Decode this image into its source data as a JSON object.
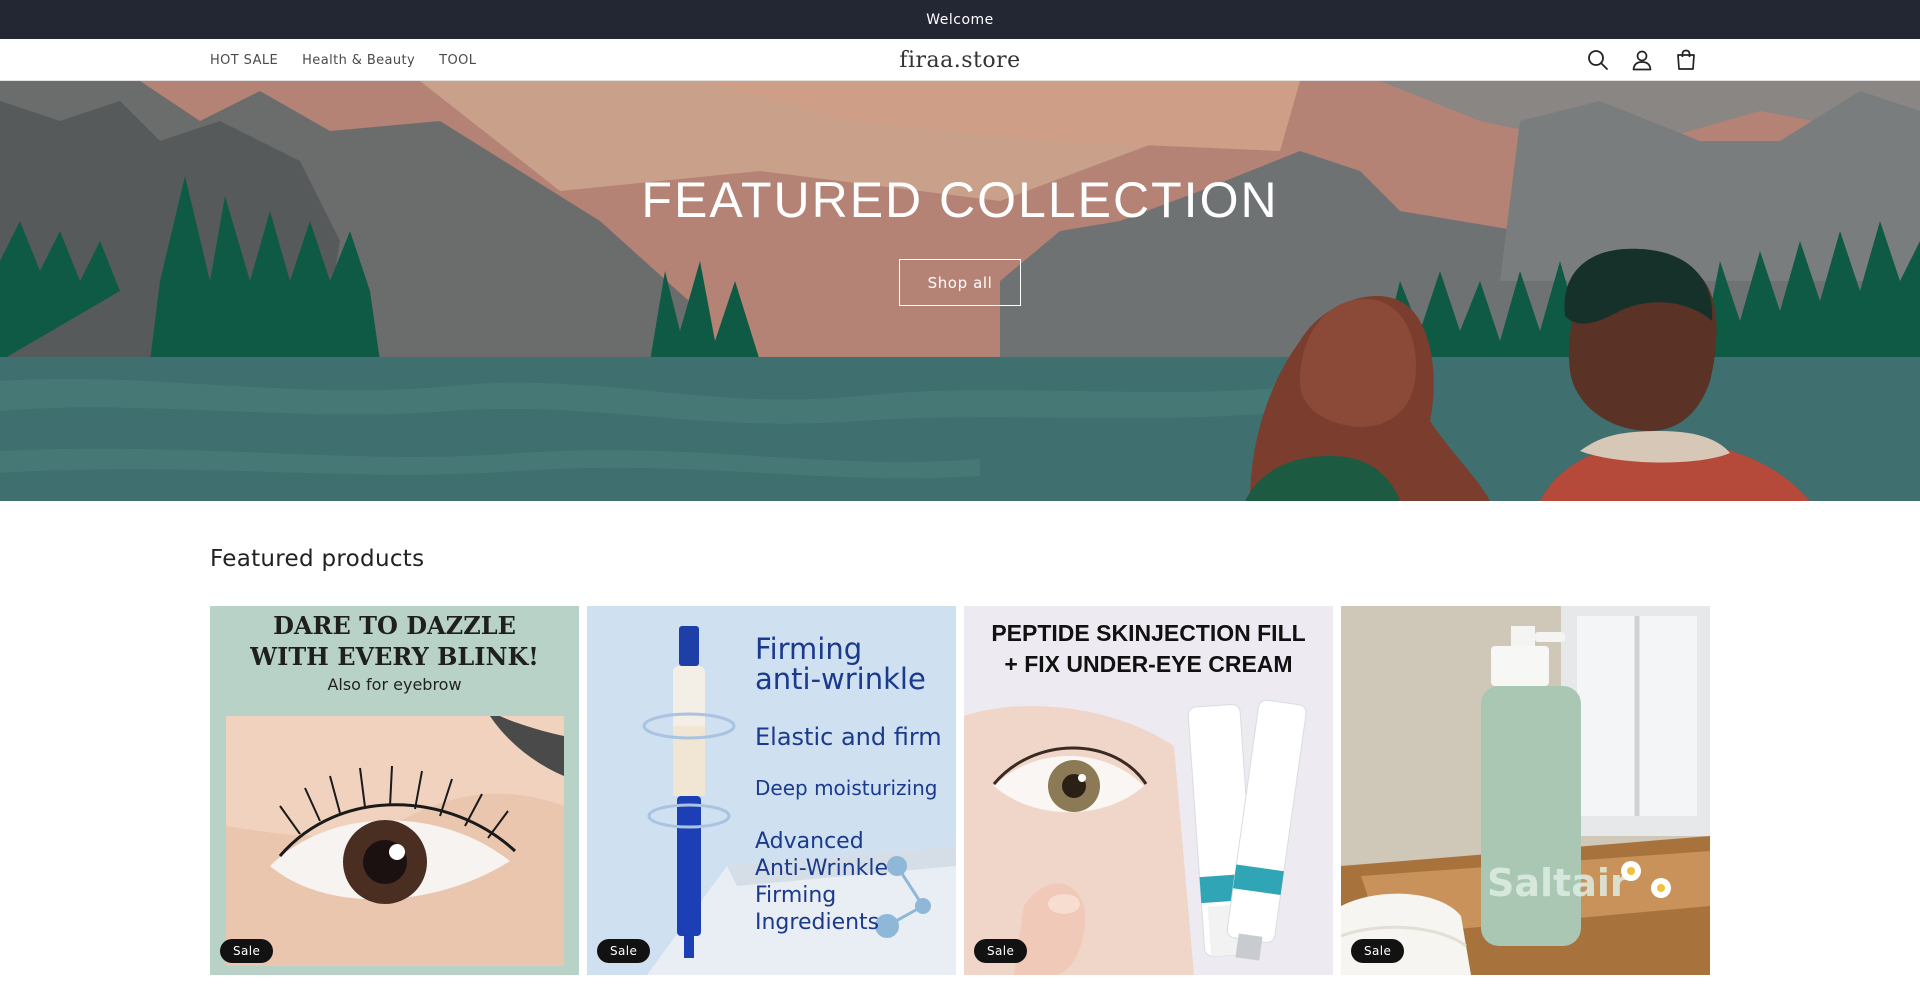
{
  "announcement": {
    "text": "Welcome"
  },
  "header": {
    "nav": [
      "HOT SALE",
      "Health & Beauty",
      "TOOL"
    ],
    "logo": "firaa.store",
    "icons": [
      "search-icon",
      "account-icon",
      "cart-icon"
    ]
  },
  "hero": {
    "title": "FEATURED COLLECTION",
    "button": "Shop all"
  },
  "featured": {
    "title": "Featured products",
    "products": [
      {
        "image_text_1": "DARE TO DAZZLE\nWITH EVERY BLINK!",
        "image_text_2": "Also for eyebrow",
        "badge": "Sale"
      },
      {
        "image_text_1": "Firming\nanti-wrinkle",
        "image_text_2": "Elastic and firm",
        "image_text_3": "Deep moisturizing",
        "image_text_4": "Advanced\nAnti-Wrinkle\nFirming\nIngredients",
        "badge": "Sale"
      },
      {
        "image_text_1": "PEPTIDE SKINJECTION FILL\n+ FIX UNDER-EYE CREAM",
        "badge": "Sale"
      },
      {
        "badge": "Sale"
      }
    ]
  },
  "colors": {
    "announcement_bg": "#232733",
    "badge_bg": "#121212",
    "hero_water": "#3f6f6e",
    "hero_trees": "#0f5a45"
  }
}
